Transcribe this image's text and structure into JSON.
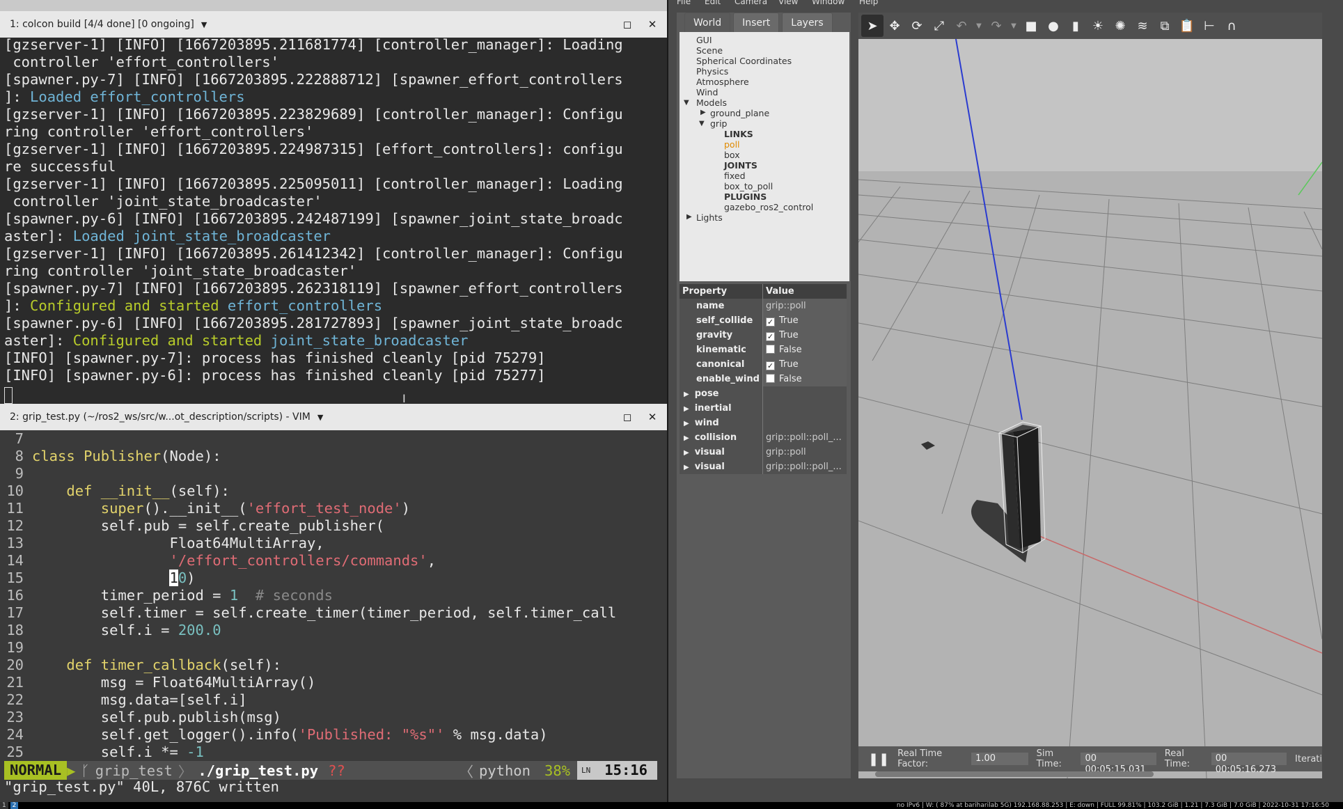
{
  "terminal1": {
    "title": "1: colcon build [4/4 done] [0 ongoing]",
    "lines": [
      [
        {
          "t": "[gzserver-1] [INFO] [1667203895.211681774] [controller_manager]: Loading"
        }
      ],
      [
        {
          "t": " controller 'effort_controllers'"
        }
      ],
      [
        {
          "t": "[spawner.py-7] [INFO] [1667203895.222888712] [spawner_effort_controllers"
        }
      ],
      [
        {
          "t": "]: "
        },
        {
          "t": "Loaded effort_controllers",
          "c": "cyan"
        }
      ],
      [
        {
          "t": "[gzserver-1] [INFO] [1667203895.223829689] [controller_manager]: Configu"
        }
      ],
      [
        {
          "t": "ring controller 'effort_controllers'"
        }
      ],
      [
        {
          "t": "[gzserver-1] [INFO] [1667203895.224987315] [effort_controllers]: configu"
        }
      ],
      [
        {
          "t": "re successful"
        }
      ],
      [
        {
          "t": "[gzserver-1] [INFO] [1667203895.225095011] [controller_manager]: Loading"
        }
      ],
      [
        {
          "t": " controller 'joint_state_broadcaster'"
        }
      ],
      [
        {
          "t": "[spawner.py-6] [INFO] [1667203895.242487199] [spawner_joint_state_broadc"
        }
      ],
      [
        {
          "t": "aster]: "
        },
        {
          "t": "Loaded joint_state_broadcaster",
          "c": "cyan"
        }
      ],
      [
        {
          "t": "[gzserver-1] [INFO] [1667203895.261412342] [controller_manager]: Configu"
        }
      ],
      [
        {
          "t": "ring controller 'joint_state_broadcaster'"
        }
      ],
      [
        {
          "t": "[spawner.py-7] [INFO] [1667203895.262318119] [spawner_effort_controllers"
        }
      ],
      [
        {
          "t": "]: "
        },
        {
          "t": "Configured and started ",
          "c": "green"
        },
        {
          "t": "effort_controllers",
          "c": "cyan"
        }
      ],
      [
        {
          "t": "[spawner.py-6] [INFO] [1667203895.281727893] [spawner_joint_state_broadc"
        }
      ],
      [
        {
          "t": "aster]: "
        },
        {
          "t": "Configured and started ",
          "c": "green"
        },
        {
          "t": "joint_state_broadcaster",
          "c": "cyan"
        }
      ],
      [
        {
          "t": "[INFO] [spawner.py-7]: process has finished cleanly [pid 75279]"
        }
      ],
      [
        {
          "t": "[INFO] [spawner.py-6]: process has finished cleanly [pid 75277]"
        }
      ]
    ]
  },
  "terminal2": {
    "title": "2: grip_test.py (~/ros2_ws/src/w...ot_description/scripts) - VIM",
    "code": [
      {
        "n": "7",
        "s": []
      },
      {
        "n": "8",
        "s": [
          {
            "t": "class ",
            "c": "yel"
          },
          {
            "t": "Publisher",
            "c": "yel"
          },
          {
            "t": "(Node):"
          }
        ]
      },
      {
        "n": "9",
        "s": []
      },
      {
        "n": "10",
        "s": [
          {
            "t": "    "
          },
          {
            "t": "def ",
            "c": "yel"
          },
          {
            "t": "__init__",
            "c": "yel"
          },
          {
            "t": "(self):"
          }
        ]
      },
      {
        "n": "11",
        "s": [
          {
            "t": "        "
          },
          {
            "t": "super",
            "c": "yel"
          },
          {
            "t": "().__init__("
          },
          {
            "t": "'effort_test_node'",
            "c": "str"
          },
          {
            "t": ")"
          }
        ]
      },
      {
        "n": "12",
        "s": [
          {
            "t": "        self.pub = self.create_publisher("
          }
        ]
      },
      {
        "n": "13",
        "s": [
          {
            "t": "                Float64MultiArray,"
          }
        ]
      },
      {
        "n": "14",
        "s": [
          {
            "t": "                "
          },
          {
            "t": "'/effort_controllers/commands'",
            "c": "str"
          },
          {
            "t": ","
          }
        ]
      },
      {
        "n": "15",
        "s": [
          {
            "t": "                "
          },
          {
            "t": "1",
            "c": "cur"
          },
          {
            "t": "0",
            "c": "num"
          },
          {
            "t": ")"
          }
        ]
      },
      {
        "n": "16",
        "s": [
          {
            "t": "        timer_period = "
          },
          {
            "t": "1",
            "c": "num"
          },
          {
            "t": "  "
          },
          {
            "t": "# seconds",
            "c": "cmt"
          }
        ]
      },
      {
        "n": "17",
        "s": [
          {
            "t": "        self.timer = self.create_timer(timer_period, self.timer_call"
          }
        ]
      },
      {
        "n": "18",
        "s": [
          {
            "t": "        self.i = "
          },
          {
            "t": "200.0",
            "c": "num"
          }
        ]
      },
      {
        "n": "19",
        "s": []
      },
      {
        "n": "20",
        "s": [
          {
            "t": "    "
          },
          {
            "t": "def ",
            "c": "yel"
          },
          {
            "t": "timer_callback",
            "c": "yel"
          },
          {
            "t": "(self):"
          }
        ]
      },
      {
        "n": "21",
        "s": [
          {
            "t": "        msg = Float64MultiArray()"
          }
        ]
      },
      {
        "n": "22",
        "s": [
          {
            "t": "        msg.data=[self.i]"
          }
        ]
      },
      {
        "n": "23",
        "s": [
          {
            "t": "        self.pub.publish(msg)"
          }
        ]
      },
      {
        "n": "24",
        "s": [
          {
            "t": "        self.get_logger().info("
          },
          {
            "t": "'Published: \"%s\"'",
            "c": "str"
          },
          {
            "t": " % msg.data)"
          }
        ]
      },
      {
        "n": "25",
        "s": [
          {
            "t": "        self.i *= "
          },
          {
            "t": "-1",
            "c": "num"
          }
        ]
      }
    ],
    "status": {
      "mode": "NORMAL",
      "branch": "grip_test",
      "file": "./grip_test.py",
      "flags": "??",
      "filetype": "python",
      "percent": "38%",
      "ln_icon": "LN",
      "position": "15:16"
    },
    "cmdline": "\"grip_test.py\" 40L, 876C written"
  },
  "gazebo": {
    "menu": [
      "File",
      "Edit",
      "Camera",
      "View",
      "Window",
      "Help"
    ],
    "tabs": [
      "World",
      "Insert",
      "Layers"
    ],
    "tree": {
      "gui": "GUI",
      "scene": "Scene",
      "spherical": "Spherical Coordinates",
      "physics": "Physics",
      "atmosphere": "Atmosphere",
      "wind": "Wind",
      "models": "Models",
      "ground_plane": "ground_plane",
      "grip": "grip",
      "links": "LINKS",
      "poll": "poll",
      "box": "box",
      "joints": "JOINTS",
      "fixed": "fixed",
      "box_to_poll": "box_to_poll",
      "plugins": "PLUGINS",
      "plugin1": "gazebo_ros2_control",
      "lights": "Lights"
    },
    "properties": {
      "header_property": "Property",
      "header_value": "Value",
      "rows": [
        {
          "name": "name",
          "value": "grip::poll",
          "check": null
        },
        {
          "name": "self_collide",
          "value": "True",
          "check": true
        },
        {
          "name": "gravity",
          "value": "True",
          "check": true
        },
        {
          "name": "kinematic",
          "value": "False",
          "check": false
        },
        {
          "name": "canonical",
          "value": "True",
          "check": true
        },
        {
          "name": "enable_wind",
          "value": "False",
          "check": false
        }
      ],
      "groups": [
        {
          "name": "pose",
          "value": ""
        },
        {
          "name": "inertial",
          "value": ""
        },
        {
          "name": "wind",
          "value": ""
        },
        {
          "name": "collision",
          "value": "grip::poll::poll_..."
        },
        {
          "name": "visual",
          "value": "grip::poll"
        },
        {
          "name": "visual",
          "value": "grip::poll::poll_..."
        }
      ]
    },
    "bottom": {
      "rtf_label": "Real Time Factor:",
      "rtf_value": "1.00",
      "sim_label": "Sim Time:",
      "sim_value": "00 00:05:15.031",
      "real_label": "Real Time:",
      "real_value": "00 00:05:16.273",
      "iter_label": "Iterati"
    }
  },
  "sysbar": {
    "workspaces": [
      "1",
      "2"
    ],
    "text": "no IPv6 | W: ( 87% at bariharilab 5G) 192.168.88.253 | E: down | FULL 99.81% | 103.2 GiB | 1.21 | 7.3 GiB | 7.0 GiB | 2022-10-31 17:16:50"
  },
  "colors": {
    "accent_green": "#a8c023",
    "cyan": "#6fb4d6",
    "selection_orange": "#e08a00"
  }
}
